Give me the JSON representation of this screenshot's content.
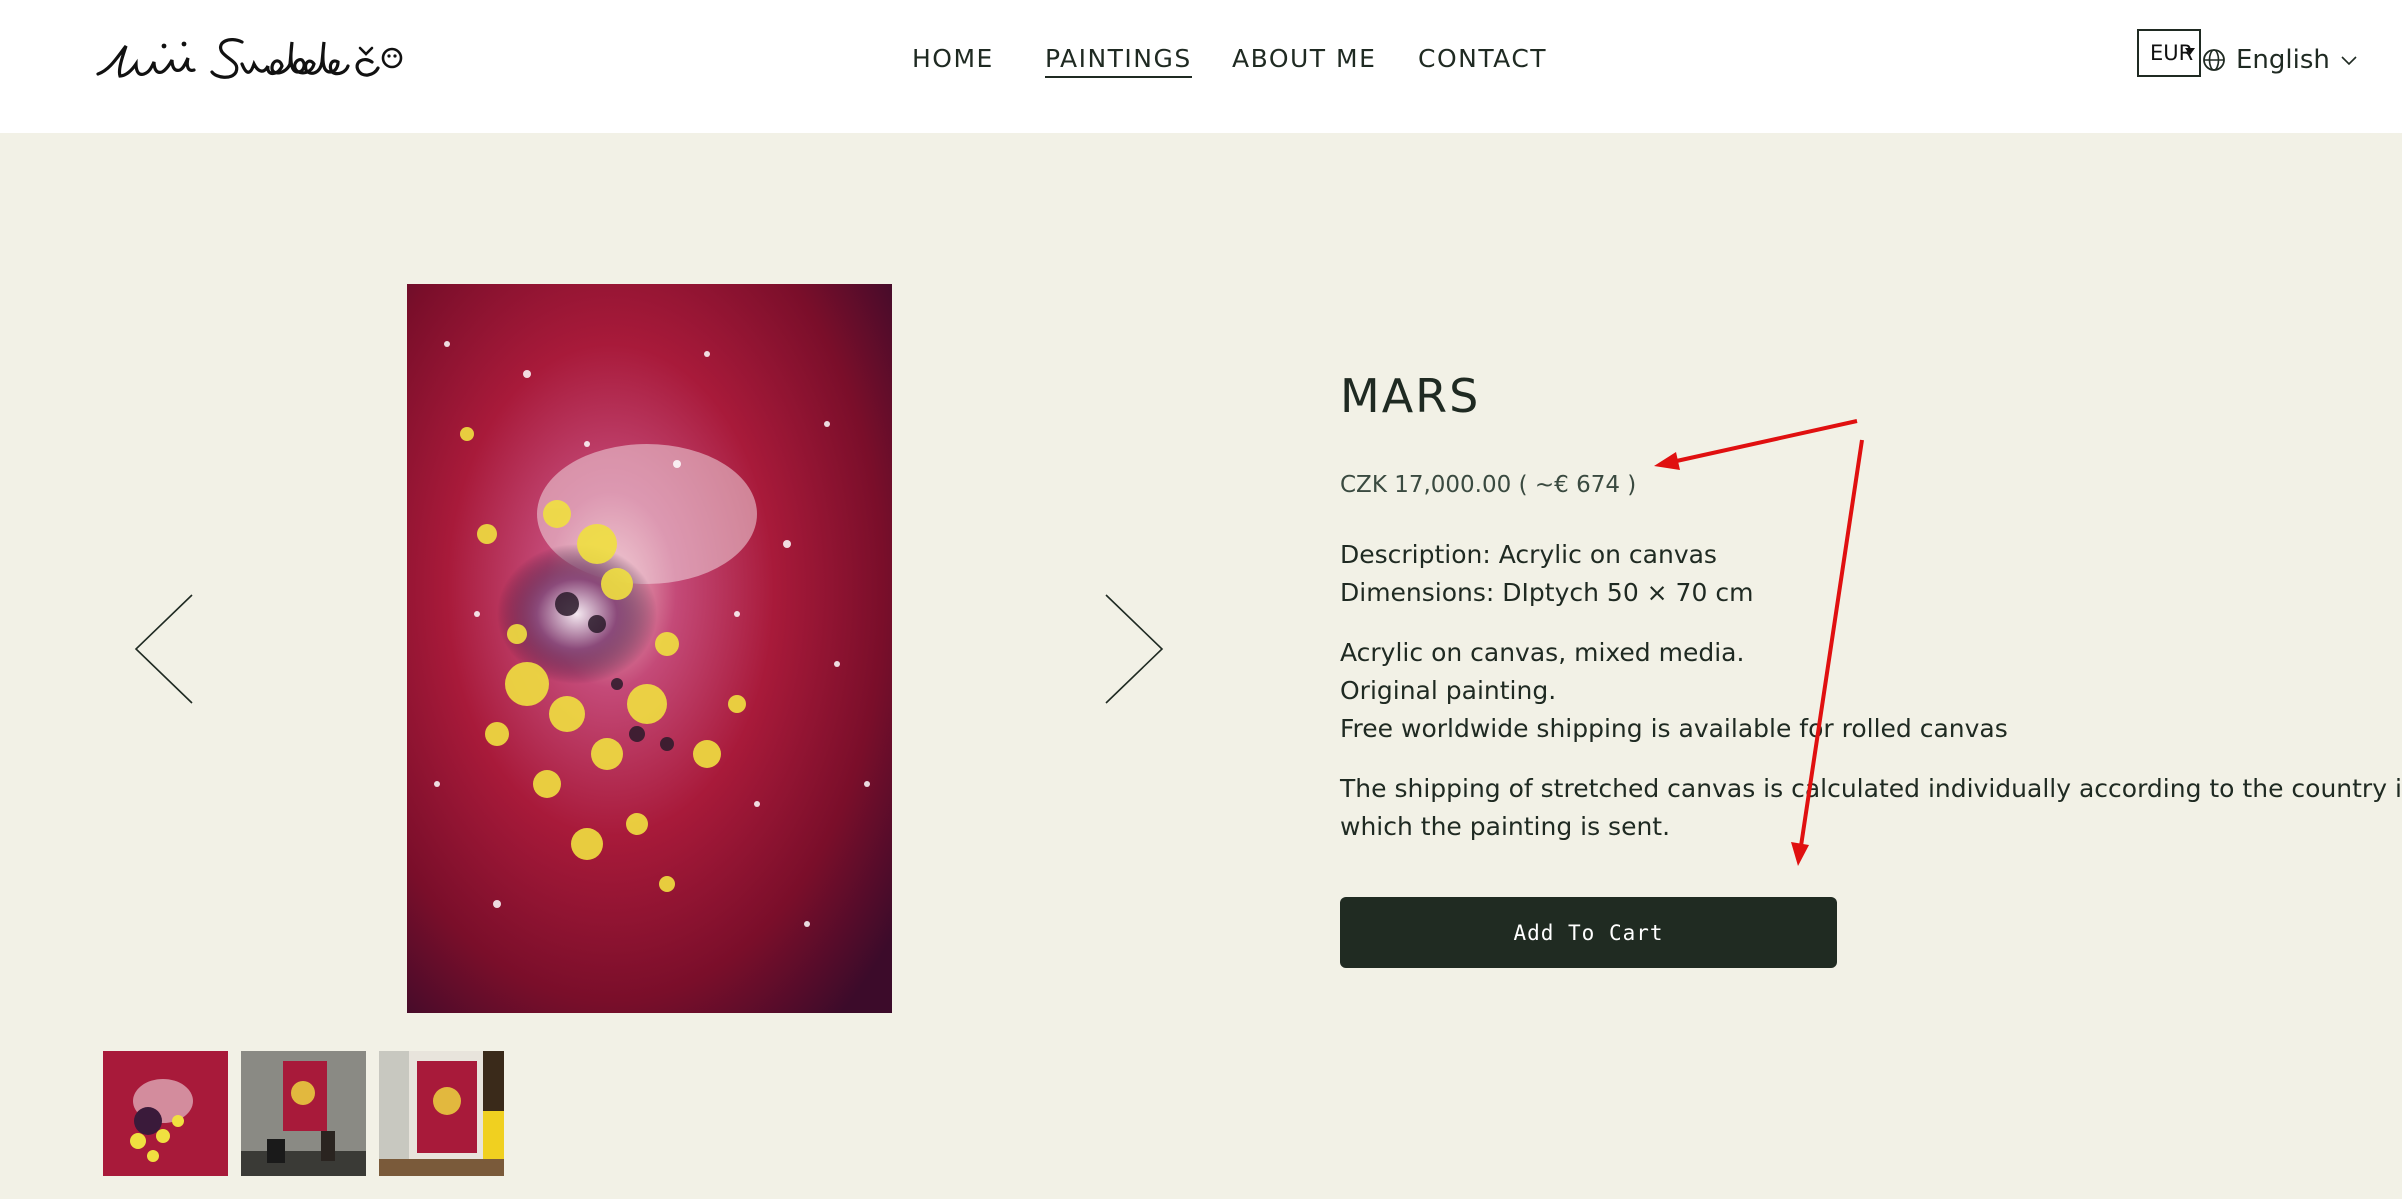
{
  "header": {
    "logo_name": "logo-signature",
    "nav": [
      {
        "label": "HOME",
        "active": false
      },
      {
        "label": "PAINTINGS",
        "active": true
      },
      {
        "label": "ABOUT ME",
        "active": false
      },
      {
        "label": "CONTACT",
        "active": false
      }
    ],
    "currency": "EUR",
    "language": "English"
  },
  "product": {
    "title": "MARS",
    "price": "CZK 17,000.00 ( ~€ 674 )",
    "details": [
      "Description: Acrylic on canvas",
      "Dimensions: DIptych 50 × 70 cm"
    ],
    "notes": [
      "Acrylic on canvas, mixed media.",
      "Original painting.",
      "Free worldwide shipping is available for rolled canvas"
    ],
    "shipping": [
      "The shipping of stretched canvas is calculated individually according to the country in",
      "which the painting is sent."
    ],
    "add_to_cart": "Add To Cart"
  },
  "gallery": {
    "prev_icon": "chevron-left-icon",
    "next_icon": "chevron-right-icon",
    "thumbnails": [
      "painting-closeup",
      "painting-on-wall",
      "painting-in-room"
    ]
  },
  "colors": {
    "background": "#f2f1e6",
    "header": "#ffffff",
    "button": "#202b22",
    "annotation": "#e01010"
  }
}
